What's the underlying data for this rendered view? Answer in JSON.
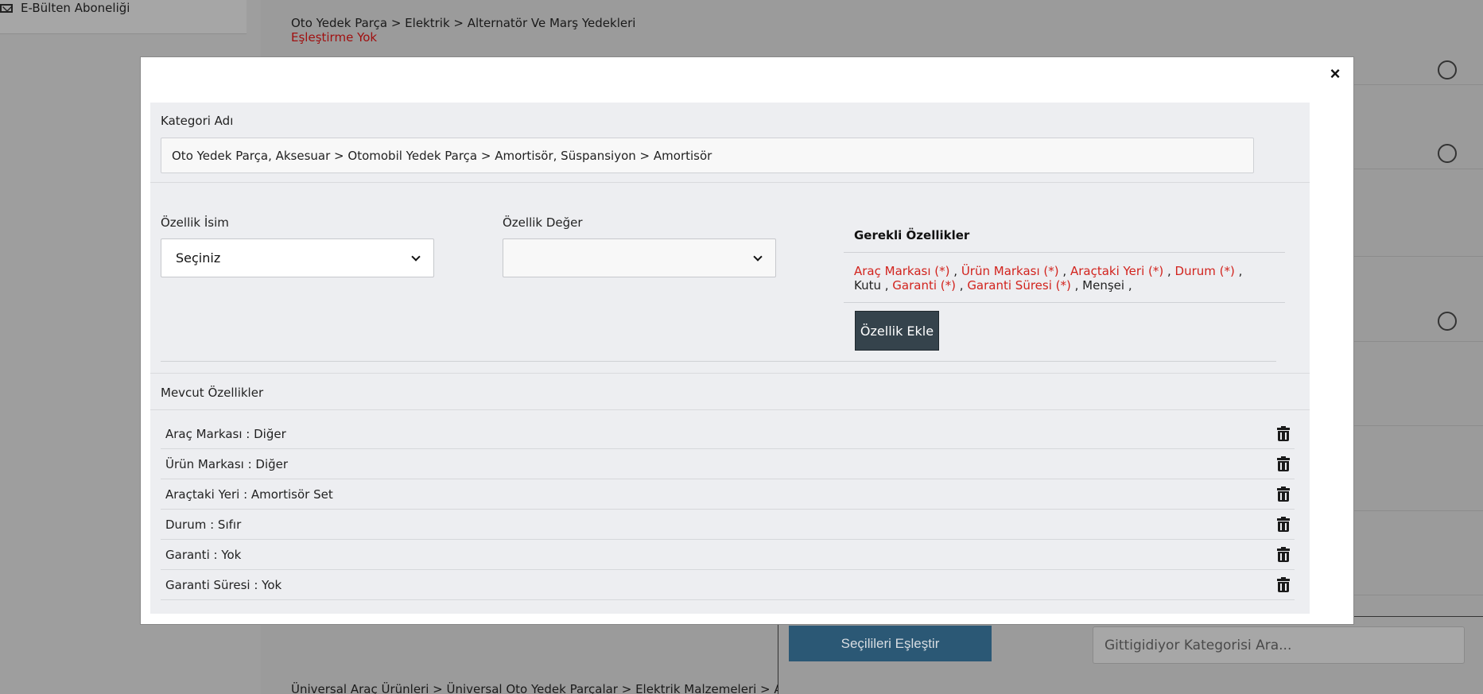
{
  "background": {
    "sidebar_item": "E-Bülten Aboneliği",
    "rows": [
      {
        "crumb": "Oto Yedek Parça > Elektrik > Alternatör Ve Marş Yedekleri",
        "status": "Eşleştirme Yok"
      }
    ],
    "bottom_crumb": "Üniversal Araç Ürünleri > Üniversal Oto Yedek Parçalar > Elektrik Malzemeleri > Ateşleme",
    "match_button": "Seçilileri Eşleştir",
    "search_placeholder": "Gittigidiyor Kategorisi Ara..."
  },
  "modal": {
    "close_label": "×",
    "category_label": "Kategori Adı",
    "category_value": "Oto Yedek Parça, Aksesuar > Otomobil Yedek Parça > Amortisör, Süspansiyon > Amortisör",
    "property_name_label": "Özellik İsim",
    "property_name_selected": "Seçiniz",
    "property_value_label": "Özellik Değer",
    "property_value_selected": "",
    "required_title": "Gerekli Özellikler",
    "required": [
      {
        "name": "Araç Markası (*)",
        "required": true
      },
      {
        "name": "Ürün Markası (*)",
        "required": true
      },
      {
        "name": "Araçtaki Yeri (*)",
        "required": true
      },
      {
        "name": "Durum (*)",
        "required": true
      },
      {
        "name": "Kutu",
        "required": false
      },
      {
        "name": "Garanti (*)",
        "required": true
      },
      {
        "name": "Garanti Süresi (*)",
        "required": true
      },
      {
        "name": "Menşei",
        "required": false
      }
    ],
    "add_button": "Özellik Ekle",
    "existing_label": "Mevcut Özellikler",
    "existing": [
      "Araç Markası : Diğer",
      "Ürün Markası : Diğer",
      "Araçtaki Yeri : Amortisör Set",
      "Durum : Sıfır",
      "Garanti : Yok",
      "Garanti Süresi : Yok"
    ]
  }
}
